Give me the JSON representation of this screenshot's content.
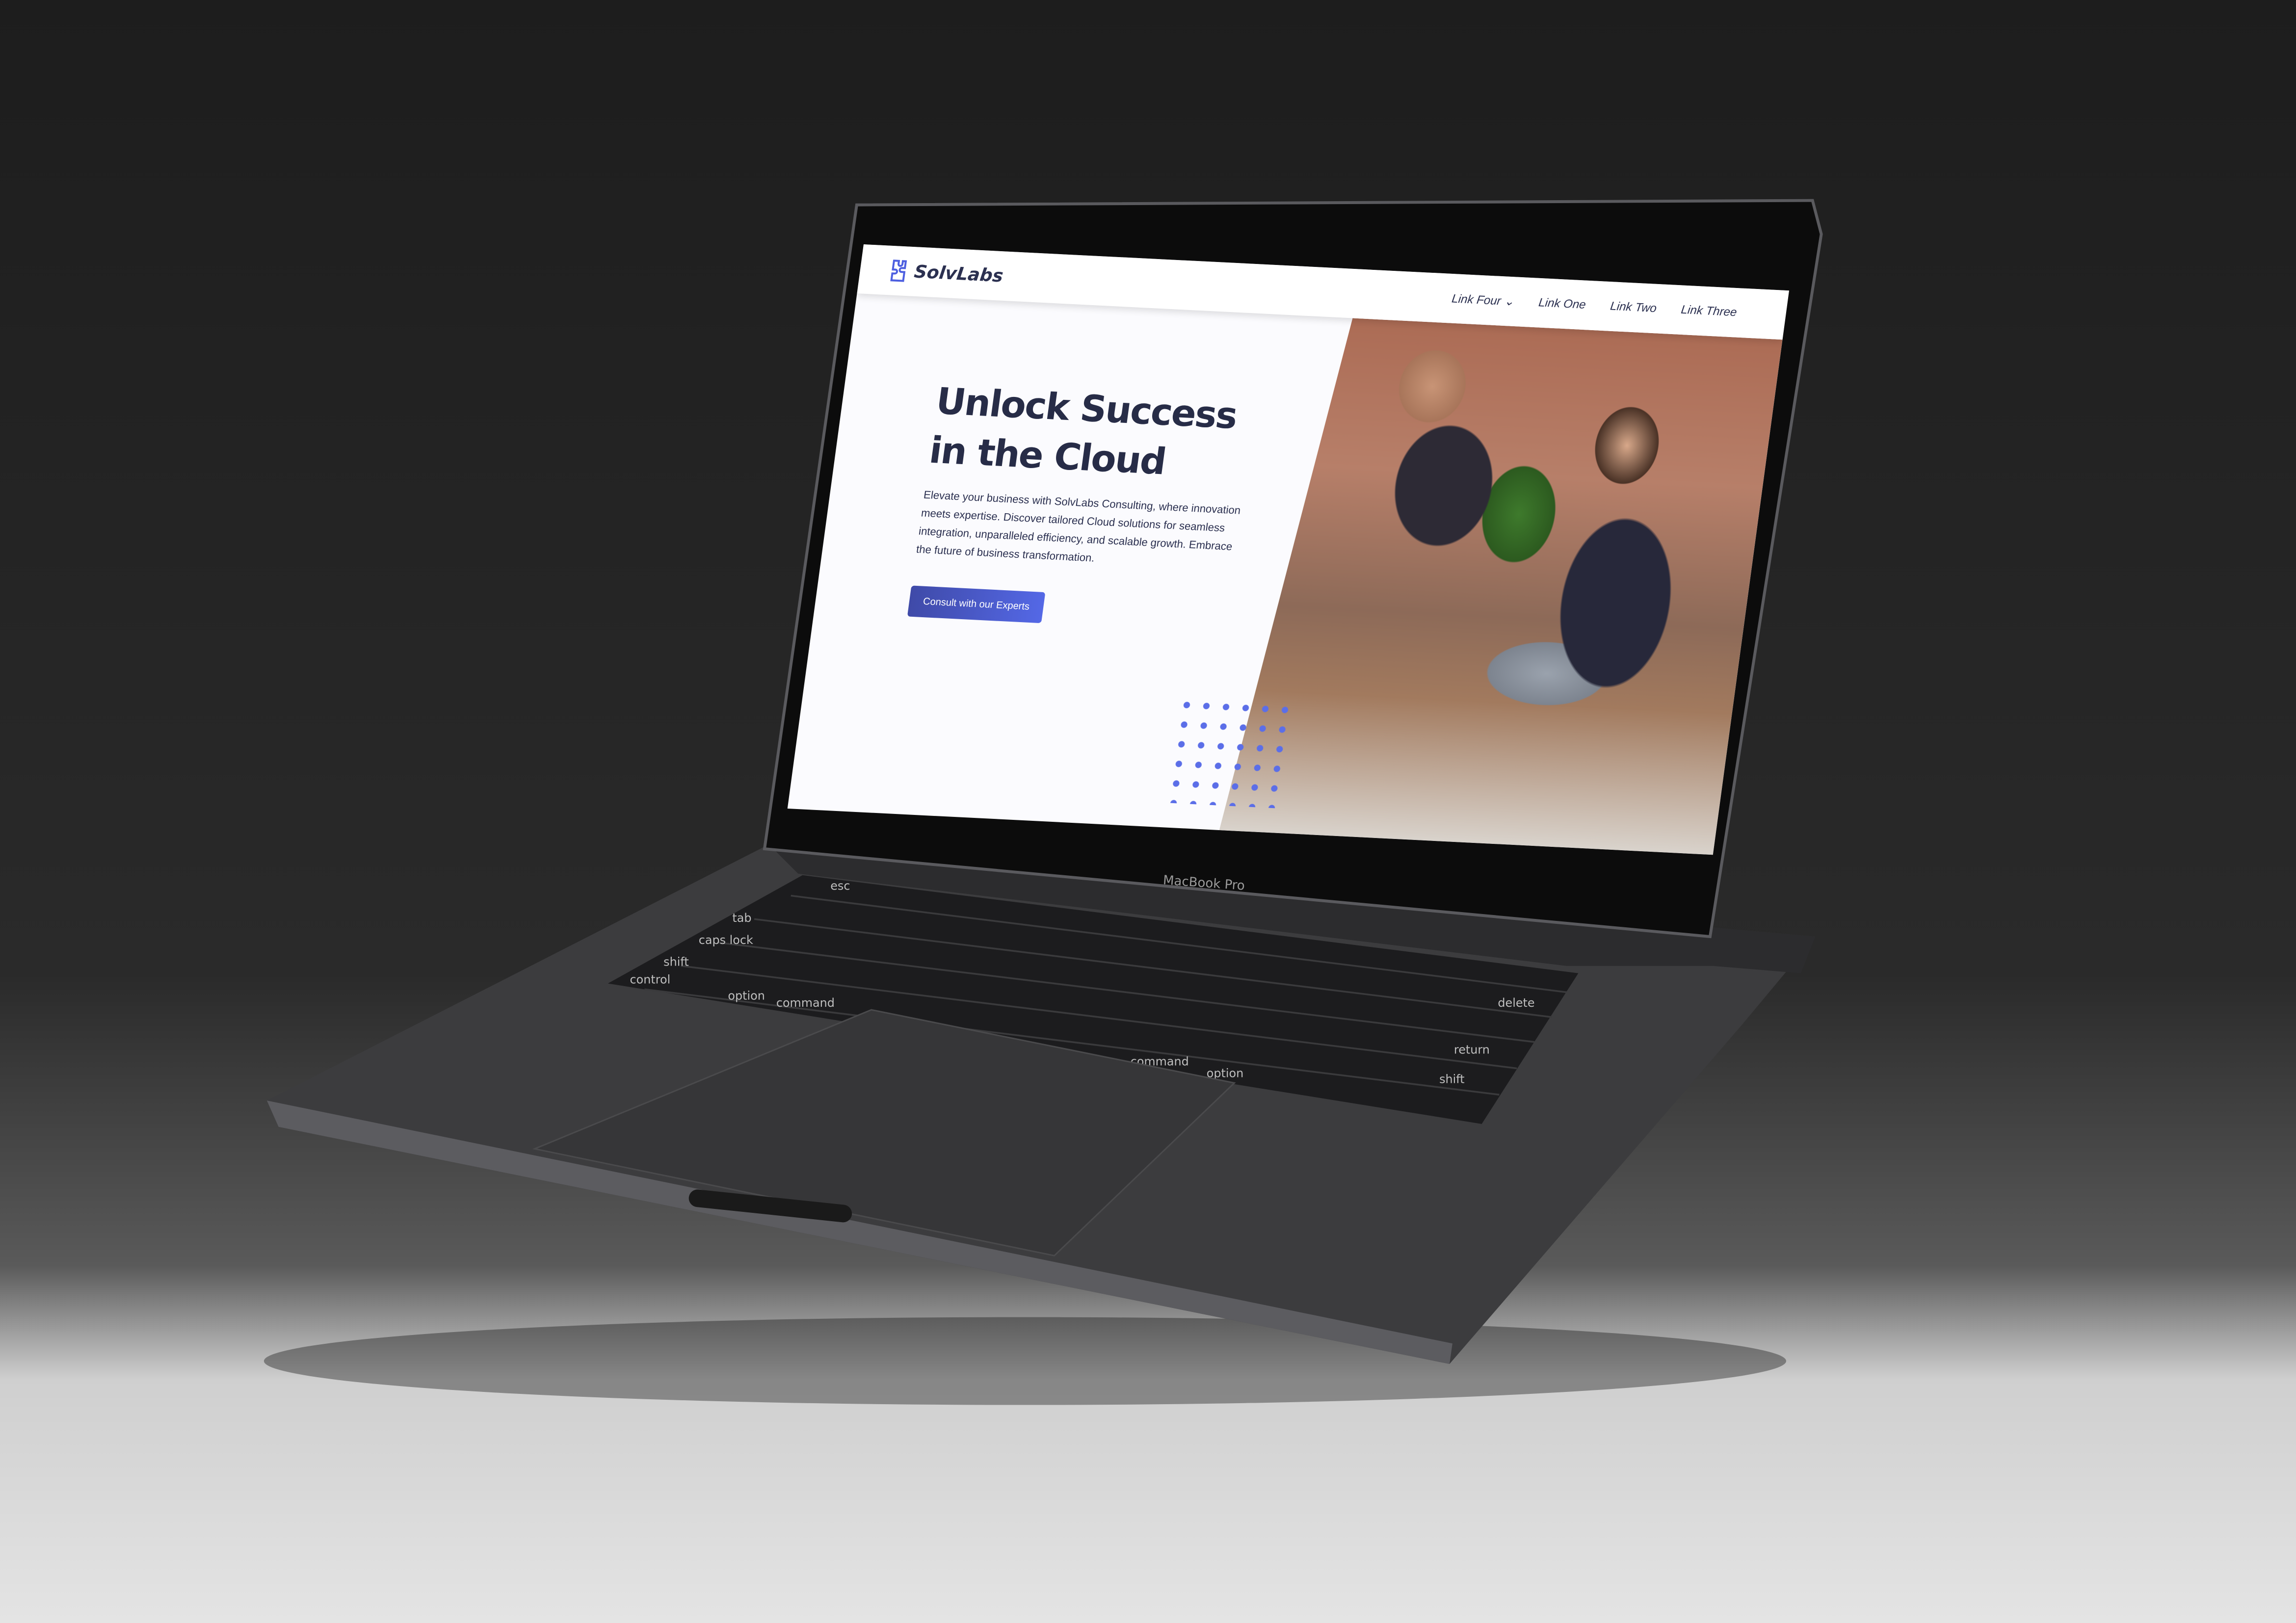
{
  "device_label": "MacBook Pro",
  "website": {
    "brand": "SolvLabs",
    "logo_icon": "puzzle-icon",
    "nav": [
      {
        "label": "Link Four",
        "has_dropdown": true
      },
      {
        "label": "Link One"
      },
      {
        "label": "Link Two"
      },
      {
        "label": "Link Three"
      }
    ],
    "hero": {
      "title_line1": "Unlock Success",
      "title_line2": "in the Cloud",
      "body": "Elevate your business with SolvLabs Consulting, where innovation meets expertise. Discover tailored Cloud solutions for seamless integration, unparalleled efficiency, and scalable growth. Embrace the future of business transformation.",
      "cta": "Consult with our Experts"
    },
    "colors": {
      "accent": "#5468e6",
      "text": "#272c47"
    }
  },
  "keyboard": {
    "keys": [
      "esc",
      "tab",
      "caps lock",
      "shift",
      "control",
      "option",
      "command",
      "command",
      "option",
      "delete",
      "return",
      "shift"
    ]
  }
}
